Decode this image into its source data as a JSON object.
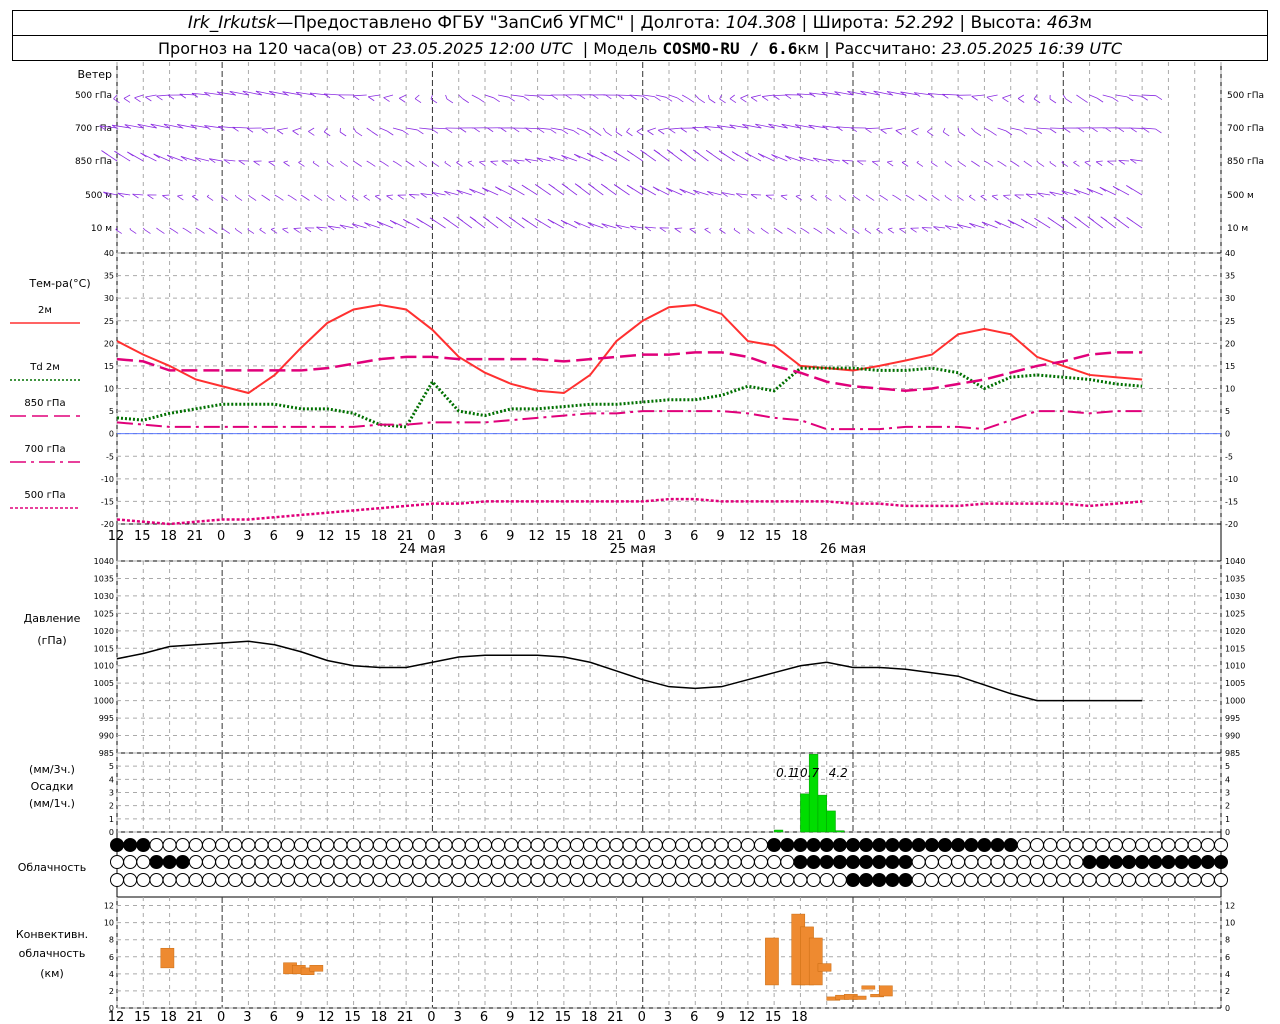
{
  "header": {
    "station": "Irk_Irkutsk",
    "dash": " — ",
    "provided_by": "Предоставлено ФГБУ \"ЗапСиб УГМС\"",
    "lon_label": "Долгота:",
    "lon_value": "104.308",
    "lat_label": "Широта:",
    "lat_value": "52.292",
    "alt_label": "Высота:",
    "alt_value": "463",
    "alt_unit": "м",
    "forecast_label": "Прогноз на 120 часа(ов) от",
    "forecast_time": "23.05.2025 12:00 UTC",
    "model_label": "Модель",
    "model_name": "COSMO-RU / 6.6",
    "model_unit": "км",
    "calc_label": "Рассчитано:",
    "calc_time": "23.05.2025 16:39 UTC",
    "sep": "|"
  },
  "colors": {
    "wind": "#8a2be2",
    "t2m": "#ff3030",
    "td2m": "#007000",
    "t850": "#e0007a",
    "t700": "#e0007a",
    "t500": "#e0007a",
    "pressure": "#000000",
    "precip": "#00dd00",
    "convective": "#ee8a30"
  },
  "chart_data": [
    {
      "type": "wind_barbs",
      "title": "Ветер",
      "levels": [
        "500 гПа",
        "700 гПа",
        "850 гПа",
        "500 м",
        "10 м"
      ]
    },
    {
      "type": "line",
      "title": "Тем-ра(°C)",
      "ylim": [
        -20,
        40
      ],
      "yticks": [
        40,
        35,
        30,
        25,
        20,
        15,
        10,
        5,
        0,
        -5,
        -10,
        -15,
        -20
      ],
      "x_hours_from_start": [
        0,
        3,
        6,
        9,
        12,
        15,
        18,
        21,
        24,
        27,
        30,
        33,
        36,
        39,
        42,
        45,
        48,
        51,
        54,
        57,
        60,
        63,
        66,
        69,
        72,
        75,
        78,
        81,
        84,
        87,
        90,
        93,
        96,
        99,
        102,
        105,
        108,
        111,
        114,
        117
      ],
      "series": [
        {
          "name": "2м",
          "style": "solid",
          "values": [
            20.5,
            17.5,
            15,
            12,
            10.5,
            9,
            13,
            19,
            24.5,
            27.5,
            28.5,
            27.5,
            23,
            17,
            13.5,
            11,
            9.5,
            9,
            13,
            20.5,
            25,
            28,
            28.5,
            26.5,
            20.5,
            19.5,
            15,
            14.5,
            14,
            15,
            16.2,
            17.5,
            22,
            23.2,
            22,
            17,
            15,
            13,
            12.5,
            12
          ]
        },
        {
          "name": "Td 2м",
          "style": "dotted",
          "values": [
            3.5,
            3,
            4.5,
            5.5,
            6.5,
            6.5,
            6.5,
            5.5,
            5.5,
            4.5,
            2,
            1.5,
            11.5,
            5,
            4,
            5.5,
            5.5,
            6,
            6.5,
            6.5,
            7,
            7.5,
            7.5,
            8.5,
            10.5,
            9.5,
            14.5,
            14.5,
            14.5,
            14,
            14,
            14.5,
            13.5,
            10,
            12.5,
            13,
            12.5,
            12,
            11,
            10.5
          ]
        },
        {
          "name": "850 гПа",
          "style": "long-dash",
          "values": [
            16.5,
            16,
            14,
            14,
            14,
            14,
            14,
            14,
            14.5,
            15.5,
            16.5,
            17,
            17,
            16.5,
            16.5,
            16.5,
            16.5,
            16,
            16.5,
            17,
            17.5,
            17.5,
            18,
            18,
            17,
            15,
            13.5,
            11.5,
            10.5,
            10,
            9.5,
            10,
            11,
            12,
            13.5,
            15,
            16,
            17.5,
            18,
            18
          ]
        },
        {
          "name": "700 гПа",
          "style": "dash-dot",
          "values": [
            2.5,
            2,
            1.5,
            1.5,
            1.5,
            1.5,
            1.5,
            1.5,
            1.5,
            1.5,
            2,
            2,
            2.5,
            2.5,
            2.5,
            3,
            3.5,
            4,
            4.5,
            4.5,
            5,
            5,
            5,
            5,
            4.5,
            3.5,
            3,
            1,
            1,
            1,
            1.5,
            1.5,
            1.5,
            1,
            3,
            5,
            5,
            4.5,
            5,
            5
          ]
        },
        {
          "name": "500 гПа",
          "style": "short-dash",
          "values": [
            -19,
            -19.5,
            -20,
            -19.5,
            -19,
            -19,
            -18.5,
            -18,
            -17.5,
            -17,
            -16.5,
            -16,
            -15.5,
            -15.5,
            -15,
            -15,
            -15,
            -15,
            -15,
            -15,
            -15,
            -14.5,
            -14.5,
            -15,
            -15,
            -15,
            -15,
            -15,
            -15.5,
            -15.5,
            -16,
            -16,
            -16,
            -15.5,
            -15.5,
            -15.5,
            -15.5,
            -16,
            -15.5,
            -15
          ]
        }
      ]
    },
    {
      "type": "line",
      "title": "Давление",
      "unit": "(гПа)",
      "ylim": [
        985,
        1040
      ],
      "yticks": [
        1040,
        1035,
        1030,
        1025,
        1020,
        1015,
        1010,
        1005,
        1000,
        995,
        990,
        985
      ],
      "x_hours_from_start": [
        0,
        3,
        6,
        9,
        12,
        15,
        18,
        21,
        24,
        27,
        30,
        33,
        36,
        39,
        42,
        45,
        48,
        51,
        54,
        57,
        60,
        63,
        66,
        69,
        72,
        75,
        78,
        81,
        84,
        87,
        90,
        93,
        96,
        99,
        102,
        105,
        108,
        111,
        114,
        117
      ],
      "series": [
        {
          "name": "Давление",
          "values": [
            1012,
            1013.5,
            1015.5,
            1016,
            1016.5,
            1017,
            1016,
            1014,
            1011.5,
            1010,
            1009.5,
            1009.5,
            1011,
            1012.5,
            1013,
            1013,
            1013,
            1012.5,
            1011,
            1008.5,
            1006,
            1004,
            1003.5,
            1004,
            1006,
            1008,
            1010,
            1011,
            1009.5,
            1009.5,
            1009,
            1008,
            1007,
            1004.5,
            1002,
            1000,
            1000,
            1000,
            1000,
            1000
          ]
        }
      ]
    },
    {
      "type": "bar",
      "title": "Осадки",
      "units": [
        "(мм/3ч.)",
        "(мм/1ч.)"
      ],
      "ylim": [
        0,
        6
      ],
      "yticks": [
        5,
        4,
        3,
        2,
        1,
        0
      ],
      "x_hours_from_start": [
        75,
        78,
        79,
        80,
        81,
        82
      ],
      "values": [
        0.15,
        2.9,
        5.9,
        2.8,
        1.6,
        0.1
      ],
      "totals_labels": [
        "0.1",
        "10.7",
        "4.2"
      ]
    },
    {
      "type": "table",
      "title": "Облачность"
    },
    {
      "type": "bar",
      "title": "Конвективн. облачность",
      "unit": "(км)",
      "ylim": [
        0,
        13
      ],
      "yticks": [
        12,
        10,
        8,
        6,
        4,
        2,
        0
      ],
      "bars": [
        {
          "x": 5,
          "bottom": 4.7,
          "top": 7.0
        },
        {
          "x": 19,
          "bottom": 4.0,
          "top": 5.3
        },
        {
          "x": 20,
          "bottom": 4.0,
          "top": 5.0
        },
        {
          "x": 21,
          "bottom": 3.9,
          "top": 4.7
        },
        {
          "x": 22,
          "bottom": 4.3,
          "top": 5.0
        },
        {
          "x": 74,
          "bottom": 2.7,
          "top": 8.2
        },
        {
          "x": 77,
          "bottom": 2.7,
          "top": 11.0
        },
        {
          "x": 78,
          "bottom": 2.7,
          "top": 9.5
        },
        {
          "x": 79,
          "bottom": 2.7,
          "top": 8.2
        },
        {
          "x": 80,
          "bottom": 4.3,
          "top": 5.2
        },
        {
          "x": 81,
          "bottom": 0.9,
          "top": 1.3
        },
        {
          "x": 82,
          "bottom": 1.0,
          "top": 1.5
        },
        {
          "x": 83,
          "bottom": 1.0,
          "top": 1.6
        },
        {
          "x": 84,
          "bottom": 1.0,
          "top": 1.4
        },
        {
          "x": 85,
          "bottom": 2.2,
          "top": 2.6
        },
        {
          "x": 86,
          "bottom": 1.3,
          "top": 1.6
        },
        {
          "x": 87,
          "bottom": 1.4,
          "top": 2.6
        }
      ]
    }
  ],
  "x_axis": {
    "hour_labels": [
      "12",
      "15",
      "18",
      "21",
      "0",
      "3",
      "6",
      "9",
      "12",
      "15",
      "18",
      "21",
      "0",
      "3",
      "6",
      "9",
      "12",
      "15",
      "18",
      "21",
      "0",
      "3",
      "6",
      "9",
      "12",
      "15",
      "18"
    ],
    "dates": [
      "24 мая",
      "25 мая",
      "26 мая"
    ]
  }
}
